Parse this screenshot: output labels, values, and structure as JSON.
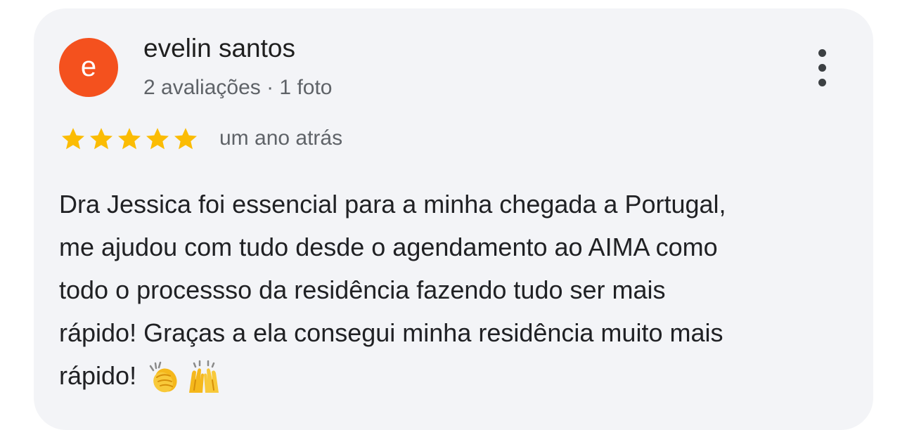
{
  "review": {
    "avatar_letter": "e",
    "avatar_color": "#f4511e",
    "author": "evelin santos",
    "author_meta": "2 avaliações · 1 foto",
    "rating": 5,
    "rating_max": 5,
    "star_color": "#fbbc04",
    "time_ago": "um ano atrás",
    "lines": [
      "Dra Jessica foi essencial para a minha chegada a Portugal,",
      "me ajudou com tudo desde o agendamento ao AIMA como",
      "todo o processso da residência fazendo tudo ser mais",
      "rápido! Graças a ela consegui minha residência muito mais",
      "rápido!"
    ],
    "emojis": [
      "clapping-hands-icon",
      "raising-hands-icon"
    ]
  }
}
